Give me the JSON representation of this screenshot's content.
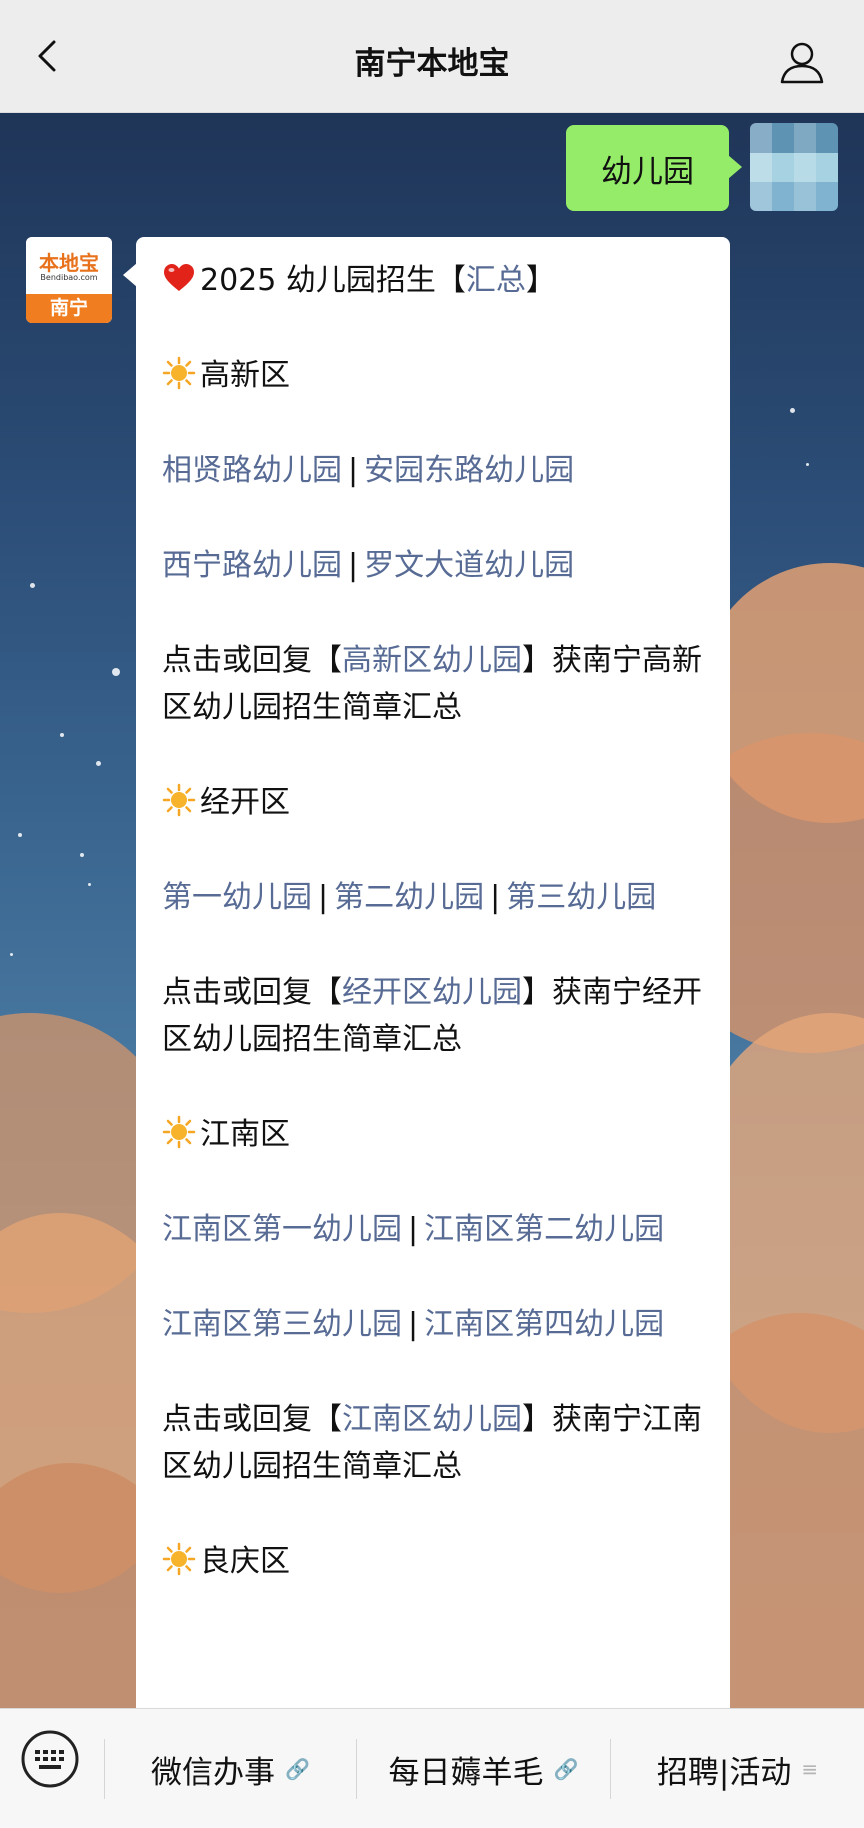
{
  "header": {
    "title": "南宁本地宝"
  },
  "user_message": {
    "text": "幼儿园"
  },
  "bot_avatar": {
    "logo_text": "本地宝",
    "logo_sub": "Bendibao.com",
    "city": "南宁"
  },
  "bot_message": {
    "line1_prefix": "2025 幼儿园招生【",
    "line1_link": "汇总",
    "line1_suffix": "】",
    "gaoxin": {
      "heading": "高新区",
      "row1_a": "相贤路幼儿园",
      "row1_b": "安园东路幼儿园",
      "row2_a": "西宁路幼儿园",
      "row2_b": "罗文大道幼儿园",
      "reply_prefix": "点击或回复【",
      "reply_link": "高新区幼儿园",
      "reply_suffix": "】获南宁高新区幼儿园招生简章汇总"
    },
    "jingkai": {
      "heading": "经开区",
      "link1": "第一幼儿园",
      "link2": "第二幼儿园",
      "link3": "第三幼儿园",
      "reply_prefix": "点击或回复【",
      "reply_link": "经开区幼儿园",
      "reply_suffix": "】获南宁经开区幼儿园招生简章汇总"
    },
    "jiangnan": {
      "heading": "江南区",
      "link1": "江南区第一幼儿园",
      "link2": "江南区第二幼儿园",
      "link3": "江南区第三幼儿园",
      "link4": "江南区第四幼儿园",
      "reply_prefix": "点击或回复【",
      "reply_link": "江南区幼儿园",
      "reply_suffix": "】获南宁江南区幼儿园招生简章汇总"
    },
    "next_heading": "良庆区",
    "separator": "|"
  },
  "bottom_menu": {
    "item1": "微信办事",
    "item2": "每日薅羊毛",
    "item3": "招聘|活动"
  },
  "colors": {
    "link": "#576b95",
    "user_bubble": "#95ec69",
    "brand_orange": "#f07d1f"
  }
}
